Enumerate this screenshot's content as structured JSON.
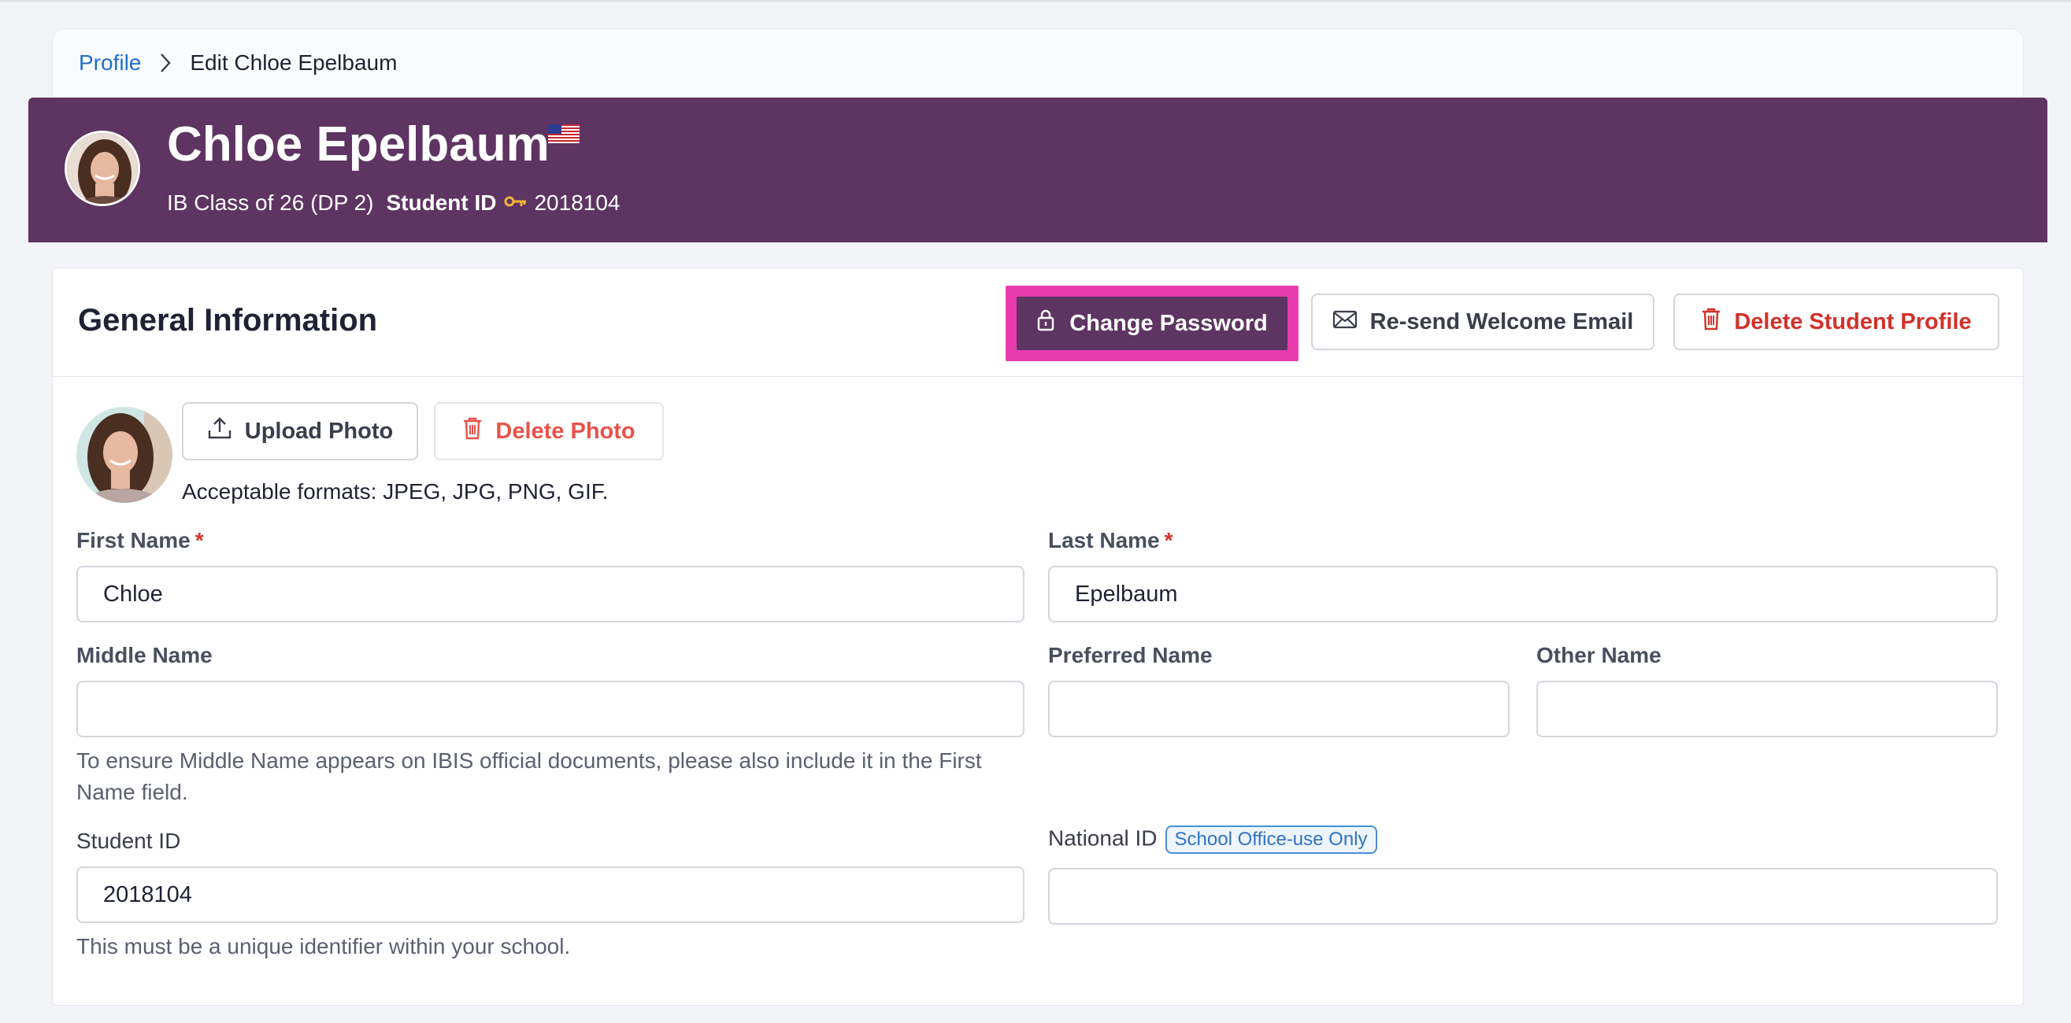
{
  "breadcrumb": {
    "root": "Profile",
    "current": "Edit Chloe Epelbaum"
  },
  "header": {
    "name": "Chloe Epelbaum",
    "flag_icon": "us-flag-icon",
    "class_info": "IB Class of 26 (DP 2)",
    "student_id_label": "Student ID",
    "student_id_icon": "key-icon",
    "student_id_value": "2018104",
    "banner_color": "#5e3462"
  },
  "section": {
    "title": "General Information",
    "buttons": {
      "change_password": "Change Password",
      "resend_welcome": "Re-send Welcome Email",
      "delete_profile": "Delete Student Profile"
    },
    "highlight_color": "#e83cae"
  },
  "photo": {
    "upload_label": "Upload Photo",
    "delete_label": "Delete Photo",
    "formats_note": "Acceptable formats: JPEG, JPG, PNG, GIF."
  },
  "form": {
    "first_name": {
      "label": "First Name",
      "required": "*",
      "value": "Chloe"
    },
    "last_name": {
      "label": "Last Name",
      "required": "*",
      "value": "Epelbaum"
    },
    "middle_name": {
      "label": "Middle Name",
      "value": "",
      "help": "To ensure Middle Name appears on IBIS official documents, please also include it in the First Name field."
    },
    "preferred_name": {
      "label": "Preferred Name",
      "value": ""
    },
    "other_name": {
      "label": "Other Name",
      "value": ""
    },
    "student_id": {
      "label": "Student ID",
      "value": "2018104",
      "help": "This must be a unique identifier within your school."
    },
    "national_id": {
      "label": "National ID",
      "badge": "School Office-use Only",
      "value": ""
    }
  }
}
